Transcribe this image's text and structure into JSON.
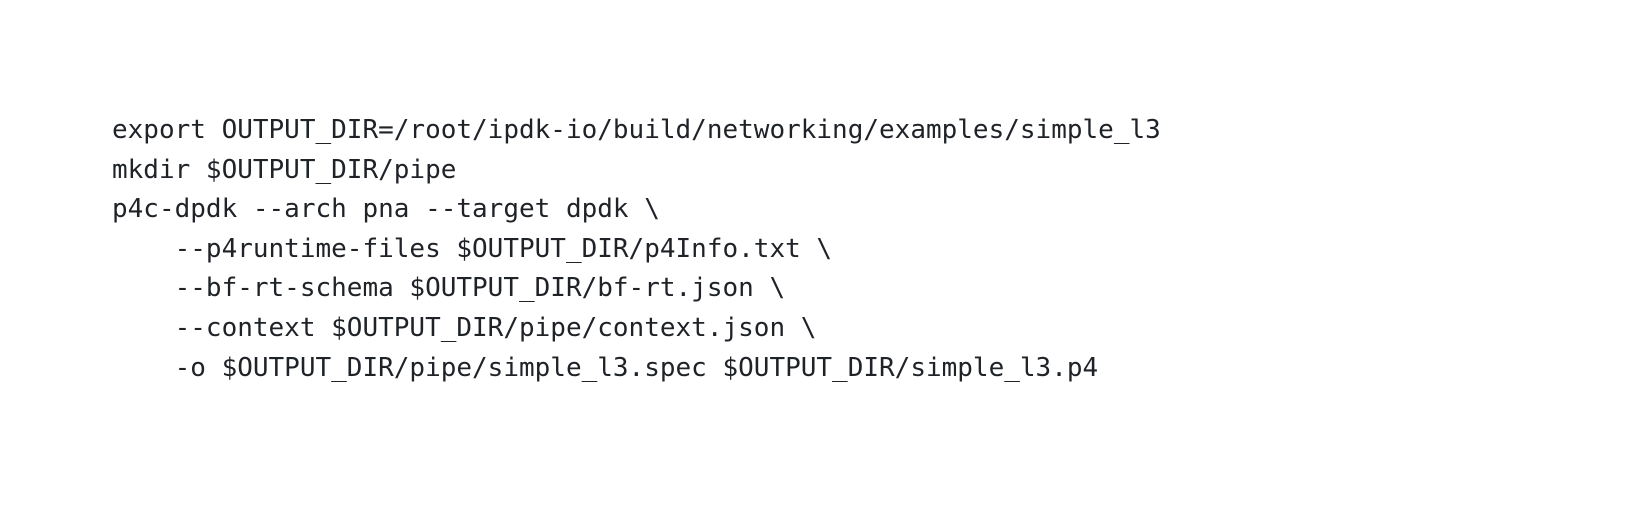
{
  "code": {
    "lines": [
      "export OUTPUT_DIR=/root/ipdk-io/build/networking/examples/simple_l3",
      "mkdir $OUTPUT_DIR/pipe",
      "p4c-dpdk --arch pna --target dpdk \\",
      "    --p4runtime-files $OUTPUT_DIR/p4Info.txt \\",
      "    --bf-rt-schema $OUTPUT_DIR/bf-rt.json \\",
      "    --context $OUTPUT_DIR/pipe/context.json \\",
      "    -o $OUTPUT_DIR/pipe/simple_l3.spec $OUTPUT_DIR/simple_l3.p4"
    ]
  }
}
